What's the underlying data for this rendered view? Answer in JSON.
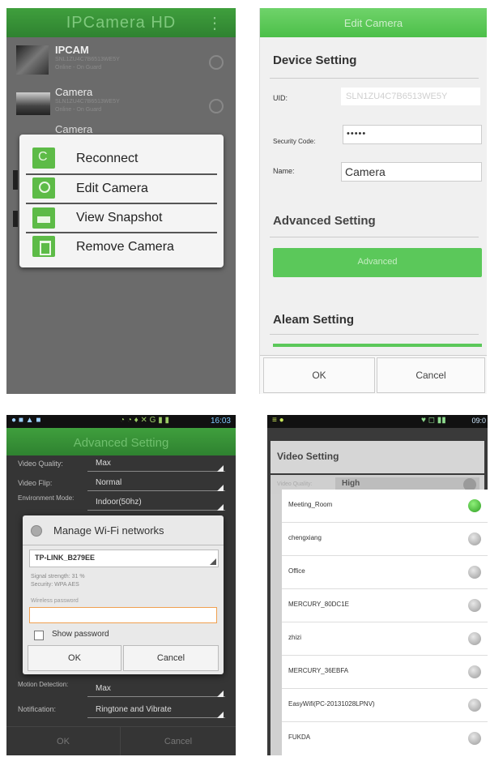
{
  "p1": {
    "title": "IPCamera HD",
    "cameras": [
      {
        "name": "IPCAM",
        "uid": "SNL1ZU4C7B6513WE5Y",
        "status": "Online - On Guard"
      },
      {
        "name": "Camera",
        "uid": "SLN1ZU4C7B6513WE5Y",
        "status": "Online - On Guard"
      },
      {
        "name": "Camera"
      }
    ],
    "menu": [
      {
        "label": "Reconnect",
        "icon": "refresh-icon"
      },
      {
        "label": "Edit Camera",
        "icon": "settings-icon"
      },
      {
        "label": "View Snapshot",
        "icon": "image-icon"
      },
      {
        "label": "Remove Camera",
        "icon": "trash-icon"
      }
    ]
  },
  "p2": {
    "title": "Edit Camera",
    "device_setting": "Device Setting",
    "uid_label": "UID:",
    "uid_value": "SLN1ZU4C7B6513WE5Y",
    "security_label": "Security Code:",
    "security_value": "•••••",
    "name_label": "Name:",
    "name_value": "Camera",
    "advanced_setting": "Advanced Setting",
    "advanced_button": "Advanced",
    "alarm_setting": "Aleam Setting",
    "ok": "OK",
    "cancel": "Cancel"
  },
  "p3": {
    "time": "16:03",
    "title": "Advanced Setting",
    "rows_top": [
      {
        "label": "Video Quality:",
        "value": "Max"
      },
      {
        "label": "Video Flip:",
        "value": "Normal"
      },
      {
        "label": "Environment Mode:",
        "value": "Indoor(50hz)"
      }
    ],
    "dialog": {
      "title": "Manage Wi-Fi networks",
      "ssid": "TP-LINK_B279EE",
      "signal": "Signal strength: 31 %",
      "security": "Security: WPA AES",
      "password_label": "Wireless password",
      "show_password": "Show password",
      "ok": "OK",
      "cancel": "Cancel"
    },
    "rows_bottom": [
      {
        "label": "Motion Detection:",
        "value": "Max"
      },
      {
        "label": "Notification:",
        "value": "Ringtone and Vibrate"
      }
    ],
    "ok": "OK",
    "cancel": "Cancel"
  },
  "p4": {
    "time": "09:0",
    "title": "Video Setting",
    "quality_label": "Video Quality:",
    "quality_value": "High",
    "networks": [
      {
        "name": "Meeting_Room",
        "selected": true
      },
      {
        "name": "chengxiang",
        "selected": false
      },
      {
        "name": "Office",
        "selected": false
      },
      {
        "name": "MERCURY_80DC1E",
        "selected": false
      },
      {
        "name": "zhizi",
        "selected": false
      },
      {
        "name": "MERCURY_36EBFA",
        "selected": false
      },
      {
        "name": "EasyWifi(PC-20131028LPNV)",
        "selected": false
      },
      {
        "name": "FUKDA",
        "selected": false
      }
    ]
  }
}
